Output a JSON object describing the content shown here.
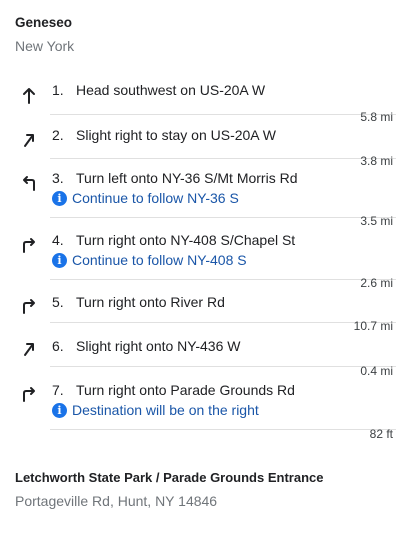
{
  "origin": {
    "name": "Geneseo",
    "region": "New York"
  },
  "steps": [
    {
      "num": "1.",
      "instruction": "Head southwest on US-20A W",
      "note": "",
      "distance": "5.8 mi",
      "icon": "arrow-up-icon"
    },
    {
      "num": "2.",
      "instruction": "Slight right to stay on US-20A W",
      "note": "",
      "distance": "3.8 mi",
      "icon": "slight-right-icon"
    },
    {
      "num": "3.",
      "instruction": "Turn left onto NY-36 S/Mt Morris Rd",
      "note": "Continue to follow NY-36 S",
      "distance": "3.5 mi",
      "icon": "turn-left-icon"
    },
    {
      "num": "4.",
      "instruction": "Turn right onto NY-408 S/Chapel St",
      "note": "Continue to follow NY-408 S",
      "distance": "2.6 mi",
      "icon": "turn-right-icon"
    },
    {
      "num": "5.",
      "instruction": "Turn right onto River Rd",
      "note": "",
      "distance": "10.7 mi",
      "icon": "turn-right-icon"
    },
    {
      "num": "6.",
      "instruction": "Slight right onto NY-436 W",
      "note": "",
      "distance": "0.4 mi",
      "icon": "slight-right-icon"
    },
    {
      "num": "7.",
      "instruction": "Turn right onto Parade Grounds Rd",
      "note": "Destination will be on the right",
      "distance": "82 ft",
      "icon": "turn-right-icon"
    }
  ],
  "destination": {
    "name": "Letchworth State Park / Parade Grounds Entrance",
    "address": "Portageville Rd, Hunt, NY 14846"
  },
  "colors": {
    "text": "#202124",
    "secondary": "#70757a",
    "link": "#1a56a8",
    "info_icon": "#1a73e8",
    "divider": "#e0e0e0"
  }
}
